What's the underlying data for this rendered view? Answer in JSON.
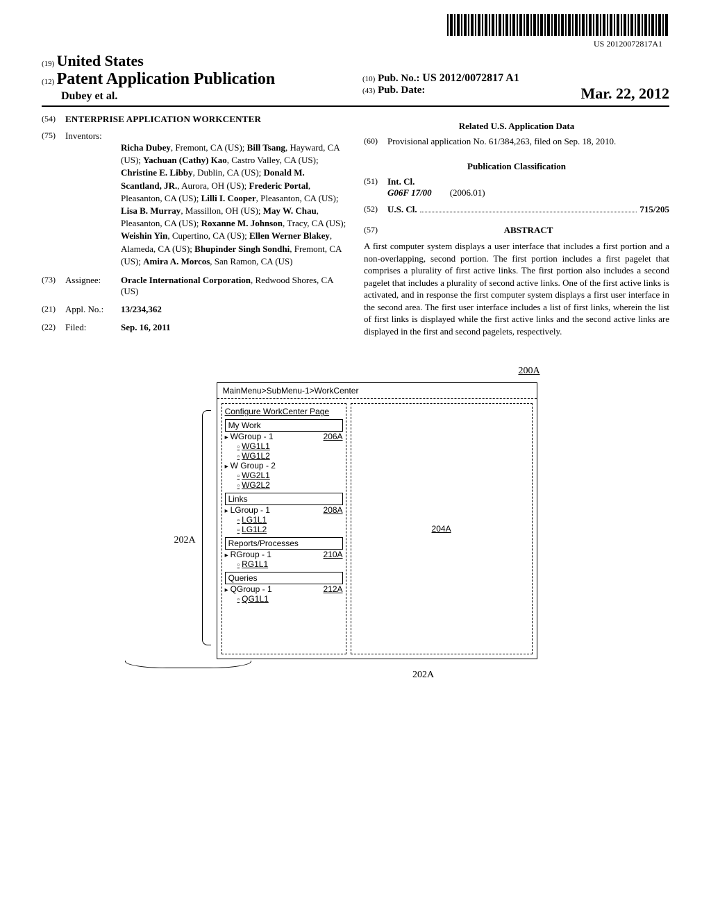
{
  "barcode_text": "US 20120072817A1",
  "header": {
    "code19": "(19)",
    "country": "United States",
    "code12": "(12)",
    "pub_title": "Patent Application Publication",
    "authors_line": "Dubey et al.",
    "code10": "(10)",
    "pub_no_label": "Pub. No.:",
    "pub_no_value": "US 2012/0072817 A1",
    "code43": "(43)",
    "pub_date_label": "Pub. Date:",
    "pub_date_value": "Mar. 22, 2012"
  },
  "left": {
    "code54": "(54)",
    "title": "ENTERPRISE APPLICATION WORKCENTER",
    "code75": "(75)",
    "inventors_label": "Inventors:",
    "inventors_value": "Richa Dubey, Fremont, CA (US); Bill Tsang, Hayward, CA (US); Yachuan (Cathy) Kao, Castro Valley, CA (US); Christine E. Libby, Dublin, CA (US); Donald M. Scantland, JR., Aurora, OH (US); Frederic Portal, Pleasanton, CA (US); Lilli I. Cooper, Pleasanton, CA (US); Lisa B. Murray, Massillon, OH (US); May W. Chau, Pleasanton, CA (US); Roxanne M. Johnson, Tracy, CA (US); Weishin Yin, Cupertino, CA (US); Ellen Werner Blakey, Alameda, CA (US); Bhupinder Singh Sondhi, Fremont, CA (US); Amira A. Morcos, San Ramon, CA (US)",
    "code73": "(73)",
    "assignee_label": "Assignee:",
    "assignee_value": "Oracle International Corporation, Redwood Shores, CA (US)",
    "code21": "(21)",
    "applno_label": "Appl. No.:",
    "applno_value": "13/234,362",
    "code22": "(22)",
    "filed_label": "Filed:",
    "filed_value": "Sep. 16, 2011"
  },
  "right": {
    "related_heading": "Related U.S. Application Data",
    "code60": "(60)",
    "related_text": "Provisional application No. 61/384,263, filed on Sep. 18, 2010.",
    "classification_heading": "Publication Classification",
    "code51": "(51)",
    "intcl_label": "Int. Cl.",
    "intcl_code": "G06F 17/00",
    "intcl_date": "(2006.01)",
    "code52": "(52)",
    "uscl_label": "U.S. Cl.",
    "uscl_value": "715/205",
    "code57": "(57)",
    "abstract_heading": "ABSTRACT",
    "abstract_text": "A first computer system displays a user interface that includes a first portion and a non-overlapping, second portion. The first portion includes a first pagelet that comprises a plurality of first active links. The first portion also includes a second pagelet that includes a plurality of second active links. One of the first active links is activated, and in response the first computer system displays a first user interface in the second area. The first user interface includes a list of first links, wherein the list of first links is displayed while the first active links and the second active links are displayed in the first and second pagelets, respectively."
  },
  "figure": {
    "top_ref": "200A",
    "side_ref": "202A",
    "breadcrumb": "MainMenu>SubMenu-1>WorkCenter",
    "configure": "Configure WorkCenter Page",
    "target_ref": "204A",
    "under_ref": "202A",
    "pagelets": [
      {
        "header": "My Work",
        "ref": "206A",
        "groups": [
          {
            "label": "WGroup - 1",
            "links": [
              "WG1L1",
              "WG1L2"
            ]
          },
          {
            "label": "W Group - 2",
            "links": [
              "WG2L1",
              "WG2L2"
            ]
          }
        ]
      },
      {
        "header": "Links",
        "ref": "208A",
        "groups": [
          {
            "label": "LGroup - 1",
            "links": [
              "LG1L1",
              "LG1L2"
            ]
          }
        ]
      },
      {
        "header": "Reports/Processes",
        "ref": "210A",
        "groups": [
          {
            "label": "RGroup - 1",
            "links": [
              "RG1L1"
            ]
          }
        ]
      },
      {
        "header": "Queries",
        "ref": "212A",
        "groups": [
          {
            "label": "QGroup - 1",
            "links": [
              "QG1L1"
            ]
          }
        ]
      }
    ]
  }
}
